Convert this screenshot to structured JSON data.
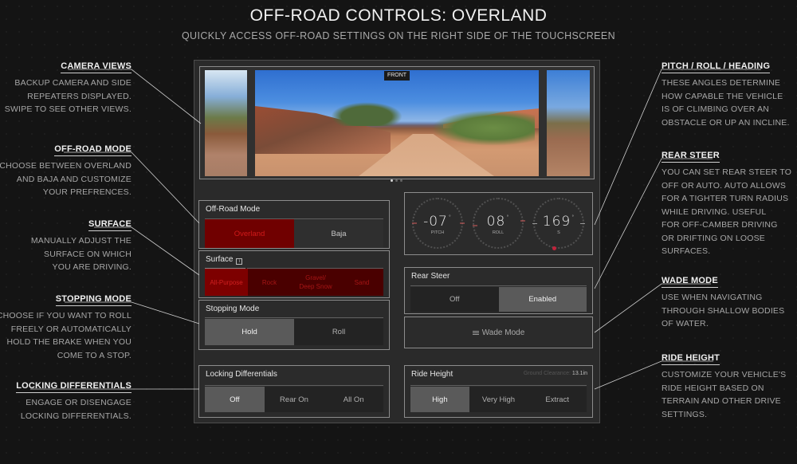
{
  "header": {
    "title": "OFF-ROAD CONTROLS: OVERLAND",
    "subtitle": "QUICKLY ACCESS OFF-ROAD SETTINGS ON THE RIGHT SIDE OF THE TOUCHSCREEN"
  },
  "annotations_left": [
    {
      "heading": "CAMERA VIEWS",
      "lines": [
        "BACKUP CAMERA AND SIDE",
        "REPEATERS DISPLAYED.",
        "SWIPE TO SEE OTHER VIEWS."
      ]
    },
    {
      "heading": "OFF-ROAD MODE",
      "lines": [
        "CHOOSE BETWEEN OVERLAND",
        "AND BAJA AND CUSTOMIZE",
        "YOUR PREFRENCES."
      ]
    },
    {
      "heading": "SURFACE",
      "lines": [
        "MANUALLY ADJUST THE",
        "SURFACE ON WHICH",
        "YOU ARE DRIVING."
      ]
    },
    {
      "heading": "STOPPING MODE",
      "lines": [
        "CHOOSE IF YOU WANT TO ROLL",
        "FREELY OR AUTOMATICALLY",
        "HOLD THE BRAKE WHEN YOU",
        "COME TO A STOP."
      ]
    },
    {
      "heading": "LOCKING DIFFERENTIALS",
      "lines": [
        "ENGAGE OR DISENGAGE",
        "LOCKING DIFFERENTIALS."
      ]
    }
  ],
  "annotations_right": [
    {
      "heading": "PITCH / ROLL / HEADING",
      "lines": [
        "THESE ANGLES DETERMINE",
        "HOW CAPABLE THE VEHICLE",
        "IS OF CLIMBING OVER AN",
        "OBSTACLE OR UP AN INCLINE."
      ]
    },
    {
      "heading": "REAR STEER",
      "lines": [
        "YOU CAN SET REAR STEER TO",
        "OFF OR AUTO. AUTO ALLOWS",
        "FOR A TIGHTER TURN RADIUS",
        "WHILE DRIVING. USEFUL",
        "FOR OFF-CAMBER DRIVING",
        "OR DRIFTING ON LOOSE",
        "SURFACES."
      ]
    },
    {
      "heading": "WADE MODE",
      "lines": [
        "USE WHEN NAVIGATING",
        "THROUGH SHALLOW BODIES",
        "OF WATER."
      ]
    },
    {
      "heading": "RIDE HEIGHT",
      "lines": [
        "CUSTOMIZE YOUR VEHICLE'S",
        "RIDE HEIGHT BASED ON",
        "TERRAIN AND OTHER DRIVE",
        "SETTINGS."
      ]
    }
  ],
  "camera": {
    "active_view_label": "FRONT",
    "views": [
      "left-repeater",
      "front",
      "right-repeater"
    ],
    "page_count": 3,
    "active_page": 0
  },
  "offroad_mode": {
    "title": "Off-Road Mode",
    "options": [
      "Overland",
      "Baja"
    ],
    "selected": "Overland"
  },
  "surface": {
    "title": "Surface",
    "info_icon": "info-icon",
    "options": [
      "All-Purpose",
      "Rock",
      "Gravel/ Deep Snow",
      "Sand"
    ],
    "selected": "All-Purpose"
  },
  "stopping_mode": {
    "title": "Stopping Mode",
    "options": [
      "Hold",
      "Roll"
    ],
    "selected": "Hold"
  },
  "locking_differentials": {
    "title": "Locking Differentials",
    "options": [
      "Off",
      "Rear On",
      "All On"
    ],
    "selected": "Off"
  },
  "gauges": [
    {
      "name": "pitch",
      "value": "-07",
      "unit": "°",
      "label": "PITCH"
    },
    {
      "name": "roll",
      "value": "08",
      "unit": "°",
      "label": "ROLL"
    },
    {
      "name": "heading",
      "value": "169",
      "unit": "°",
      "label": "S"
    }
  ],
  "rear_steer": {
    "title": "Rear Steer",
    "options": [
      "Off",
      "Enabled"
    ],
    "selected": "Enabled"
  },
  "wade_mode": {
    "label": "Wade Mode",
    "icon": "water-icon"
  },
  "ride_height": {
    "title": "Ride Height",
    "clearance_label": "Ground Clearance:",
    "clearance_value": "13.1in",
    "options": [
      "High",
      "Very High",
      "Extract"
    ],
    "selected": "High"
  },
  "colors": {
    "background": "#141414",
    "panel": "#2a2a2a",
    "selected_gray": "#5a5a5a",
    "overland_red": "#7d0000",
    "red_text": "#d02020",
    "heading_dot": "#c2233b"
  }
}
